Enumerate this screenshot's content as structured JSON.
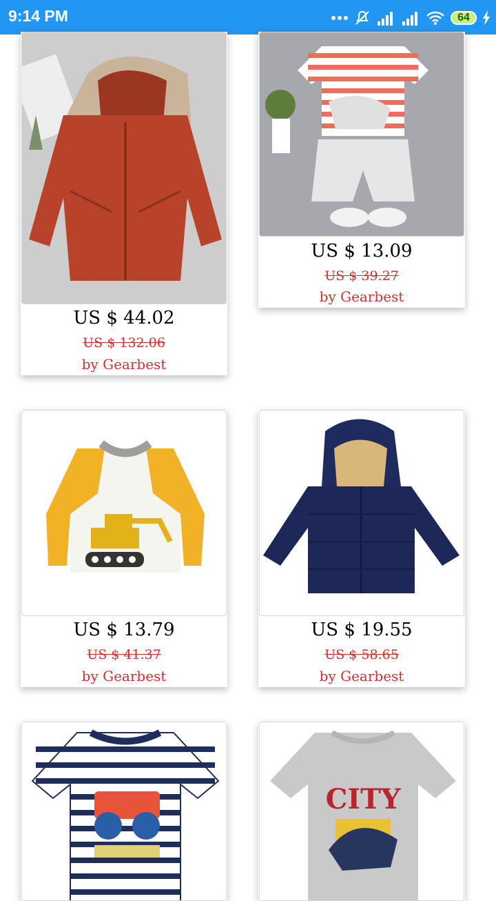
{
  "status": {
    "time": "9:14 PM",
    "battery": "64"
  },
  "products": [
    {
      "price": "US $ 44.02",
      "old_price": "US $ 132.06",
      "seller": "by Gearbest",
      "image": "red-hooded-coat"
    },
    {
      "price": "US $ 13.09",
      "old_price": "US $ 39.27",
      "seller": "by Gearbest",
      "image": "striped-tshirt-shorts-set"
    },
    {
      "price": "US $ 13.79",
      "old_price": "US $ 41.37",
      "seller": "by Gearbest",
      "image": "excavator-long-sleeve-tee"
    },
    {
      "price": "US $ 19.55",
      "old_price": "US $ 58.65",
      "seller": "by Gearbest",
      "image": "navy-puffer-jacket"
    },
    {
      "price": "",
      "old_price": "",
      "seller": "",
      "image": "monster-truck-striped-tee"
    },
    {
      "price": "",
      "old_price": "",
      "seller": "",
      "image": "city-dinosaur-tee"
    }
  ],
  "colors": {
    "status_bar": "#2196F3",
    "accent_red": "#d32f2f"
  }
}
